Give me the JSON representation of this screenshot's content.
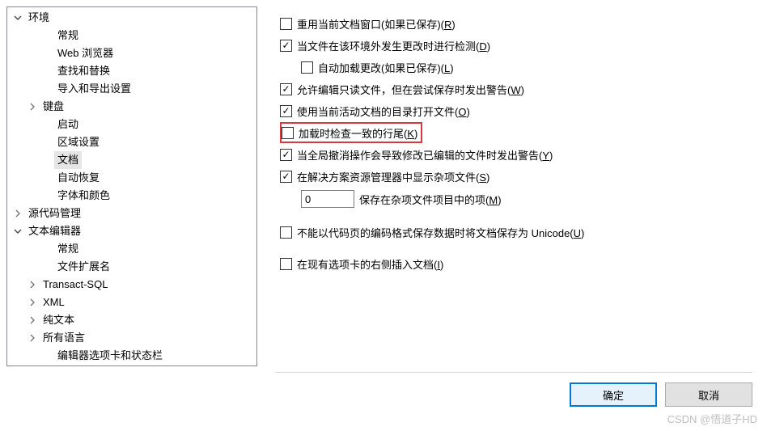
{
  "tree": [
    {
      "label": "环境",
      "indent": 0,
      "expander": "open",
      "selected": false
    },
    {
      "label": "常规",
      "indent": 2,
      "expander": "none",
      "selected": false
    },
    {
      "label": "Web 浏览器",
      "indent": 2,
      "expander": "none",
      "selected": false
    },
    {
      "label": "查找和替换",
      "indent": 2,
      "expander": "none",
      "selected": false
    },
    {
      "label": "导入和导出设置",
      "indent": 2,
      "expander": "none",
      "selected": false
    },
    {
      "label": "键盘",
      "indent": 1,
      "expander": "closed",
      "selected": false
    },
    {
      "label": "启动",
      "indent": 2,
      "expander": "none",
      "selected": false
    },
    {
      "label": "区域设置",
      "indent": 2,
      "expander": "none",
      "selected": false
    },
    {
      "label": "文档",
      "indent": 2,
      "expander": "none",
      "selected": true
    },
    {
      "label": "自动恢复",
      "indent": 2,
      "expander": "none",
      "selected": false
    },
    {
      "label": "字体和颜色",
      "indent": 2,
      "expander": "none",
      "selected": false
    },
    {
      "label": "源代码管理",
      "indent": 0,
      "expander": "closed",
      "selected": false
    },
    {
      "label": "文本编辑器",
      "indent": 0,
      "expander": "open",
      "selected": false
    },
    {
      "label": "常规",
      "indent": 2,
      "expander": "none",
      "selected": false
    },
    {
      "label": "文件扩展名",
      "indent": 2,
      "expander": "none",
      "selected": false
    },
    {
      "label": "Transact-SQL",
      "indent": 1,
      "expander": "closed",
      "selected": false
    },
    {
      "label": "XML",
      "indent": 1,
      "expander": "closed",
      "selected": false
    },
    {
      "label": "纯文本",
      "indent": 1,
      "expander": "closed",
      "selected": false
    },
    {
      "label": "所有语言",
      "indent": 1,
      "expander": "closed",
      "selected": false
    },
    {
      "label": "编辑器选项卡和状态栏",
      "indent": 2,
      "expander": "none",
      "selected": false
    }
  ],
  "options": {
    "reuse_window": {
      "checked": false,
      "text": "重用当前文档窗口(如果已保存)(",
      "accel": "R",
      "tail": ")"
    },
    "detect_changes": {
      "checked": true,
      "text": "当文件在该环境外发生更改时进行检测(",
      "accel": "D",
      "tail": ")"
    },
    "auto_load": {
      "checked": false,
      "text": "自动加载更改(如果已保存)(",
      "accel": "L",
      "tail": ")"
    },
    "allow_readonly": {
      "checked": true,
      "text": "允许编辑只读文件，但在尝试保存时发出警告(",
      "accel": "W",
      "tail": ")"
    },
    "open_with_dir": {
      "checked": true,
      "text": "使用当前活动文档的目录打开文件(",
      "accel": "O",
      "tail": ")"
    },
    "check_line_ending": {
      "checked": false,
      "text": "加载时检查一致的行尾(",
      "accel": "K",
      "tail": ")"
    },
    "undo_warn": {
      "checked": true,
      "text": "当全局撤消操作会导致修改已编辑的文件时发出警告(",
      "accel": "Y",
      "tail": ")"
    },
    "show_misc": {
      "checked": true,
      "text": "在解决方案资源管理器中显示杂项文件(",
      "accel": "S",
      "tail": ")"
    },
    "misc_count": {
      "value": "0",
      "text": "保存在杂项文件项目中的项(",
      "accel": "M",
      "tail": ")"
    },
    "unicode": {
      "checked": false,
      "text": "不能以代码页的编码格式保存数据时将文档保存为 Unicode(",
      "accel": "U",
      "tail": ")"
    },
    "insert_right": {
      "checked": false,
      "text": "在现有选项卡的右侧插入文档(",
      "accel": "I",
      "tail": ")"
    }
  },
  "buttons": {
    "ok": "确定",
    "cancel": "取消"
  },
  "watermark": "CSDN @悟道子HD"
}
